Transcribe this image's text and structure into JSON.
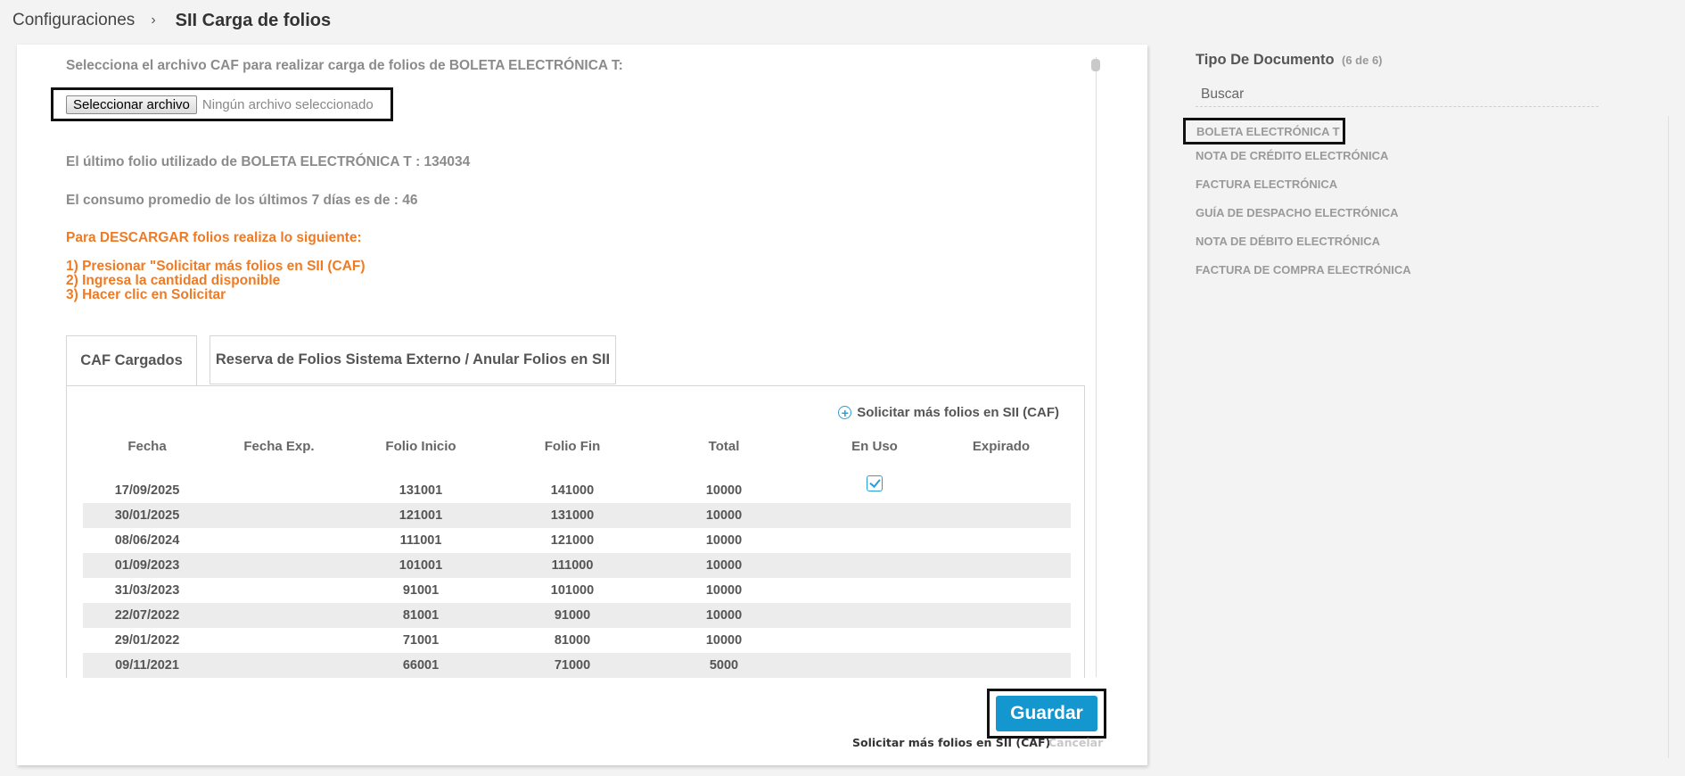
{
  "breadcrumb": {
    "parent": "Configuraciones",
    "separator": "›",
    "current": "SII Carga de folios"
  },
  "upload": {
    "label": "Selecciona el archivo CAF para realizar carga de folios de BOLETA ELECTRÓNICA T:",
    "button_label": "Seleccionar archivo",
    "status": "Ningún archivo seleccionado"
  },
  "info": {
    "last_folio": "El último folio utilizado de BOLETA ELECTRÓNICA T : 134034",
    "avg_consumption": "El consumo promedio de los últimos 7 días es de : 46"
  },
  "instructions": {
    "title": "Para DESCARGAR folios realiza lo siguiente:",
    "steps": [
      "1) Presionar \"Solicitar más folios en SII (CAF)",
      "2) Ingresa la cantidad disponible",
      "3) Hacer clic en Solicitar"
    ]
  },
  "tabs": [
    {
      "label": "CAF Cargados",
      "active": true
    },
    {
      "label": "Reserva de Folios Sistema Externo / Anular Folios en SII",
      "active": false
    }
  ],
  "table": {
    "request_link": "Solicitar más folios en SII (CAF)",
    "columns": [
      "Fecha",
      "Fecha Exp.",
      "Folio Inicio",
      "Folio Fin",
      "Total",
      "En Uso",
      "Expirado"
    ],
    "rows": [
      {
        "fecha": "17/09/2025",
        "fecha_exp": "",
        "inicio": "131001",
        "fin": "141000",
        "total": "10000",
        "en_uso": true,
        "expirado": false
      },
      {
        "fecha": "30/01/2025",
        "fecha_exp": "",
        "inicio": "121001",
        "fin": "131000",
        "total": "10000",
        "en_uso": false,
        "expirado": false
      },
      {
        "fecha": "08/06/2024",
        "fecha_exp": "",
        "inicio": "111001",
        "fin": "121000",
        "total": "10000",
        "en_uso": false,
        "expirado": false
      },
      {
        "fecha": "01/09/2023",
        "fecha_exp": "",
        "inicio": "101001",
        "fin": "111000",
        "total": "10000",
        "en_uso": false,
        "expirado": false
      },
      {
        "fecha": "31/03/2023",
        "fecha_exp": "",
        "inicio": "91001",
        "fin": "101000",
        "total": "10000",
        "en_uso": false,
        "expirado": false
      },
      {
        "fecha": "22/07/2022",
        "fecha_exp": "",
        "inicio": "81001",
        "fin": "91000",
        "total": "10000",
        "en_uso": false,
        "expirado": false
      },
      {
        "fecha": "29/01/2022",
        "fecha_exp": "",
        "inicio": "71001",
        "fin": "81000",
        "total": "10000",
        "en_uso": false,
        "expirado": false
      },
      {
        "fecha": "09/11/2021",
        "fecha_exp": "",
        "inicio": "66001",
        "fin": "71000",
        "total": "5000",
        "en_uso": false,
        "expirado": false
      }
    ]
  },
  "footer": {
    "save_label": "Guardar",
    "request_label": "Solicitar más folios en SII (CAF)",
    "cancel_label": "Cancelar"
  },
  "doc_types": {
    "title": "Tipo De Documento",
    "count": "(6 de 6)",
    "search_placeholder": "Buscar",
    "items": [
      "BOLETA ELECTRÓNICA T",
      "NOTA DE CRÉDITO ELECTRÓNICA",
      "FACTURA ELECTRÓNICA",
      "GUÍA DE DESPACHO ELECTRÓNICA",
      "NOTA DE DÉBITO ELECTRÓNICA",
      "FACTURA DE COMPRA ELECTRÓNICA"
    ],
    "selected_index": 0
  },
  "colors": {
    "accent": "#1496ce",
    "instructions": "#f07a22",
    "check": "#2a9fd6"
  }
}
